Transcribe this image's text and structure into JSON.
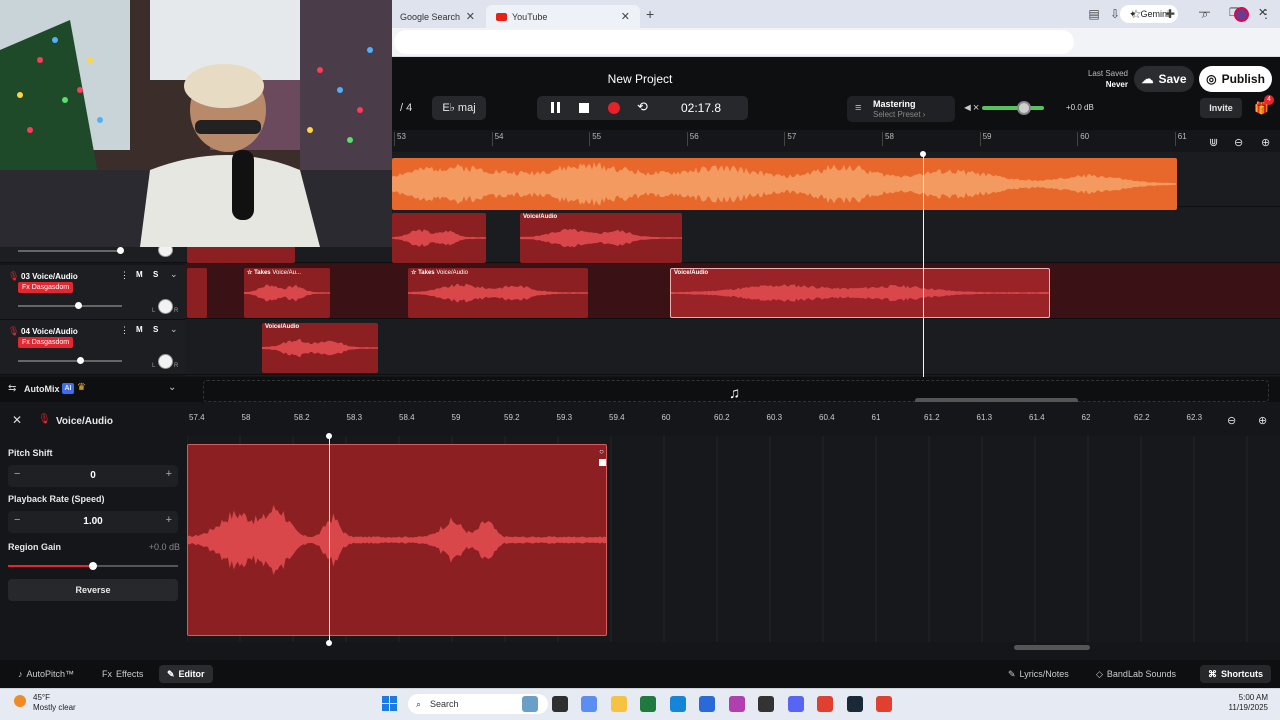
{
  "browser": {
    "tabs": [
      {
        "label": "Google Search"
      },
      {
        "label": "YouTube"
      }
    ],
    "new_tab": "+",
    "gemini": "Gemini",
    "close_glyph": "✕"
  },
  "header": {
    "title": "New Project",
    "last_saved_label": "Last Saved",
    "last_saved_value": "Never",
    "save": "Save",
    "publish": "Publish",
    "bpm_fragment": "/ 4",
    "key": "E♭ maj",
    "time": "02:17.8",
    "mastering": "Mastering",
    "mastering_preset": "Select Preset",
    "volume_readout": "+0.0 dB",
    "volume_level": 0.69,
    "invite": "Invite",
    "notification_count": "4"
  },
  "ruler": {
    "bars": [
      "53",
      "54",
      "55",
      "56",
      "57",
      "58",
      "59",
      "60",
      "61"
    ]
  },
  "tracks": [
    {
      "number": "03",
      "name": "Voice/Audio",
      "fx": "Fx Dasgasdom",
      "m": "M",
      "s": "S",
      "volume": 0.58
    },
    {
      "number": "04",
      "name": "Voice/Audio",
      "fx": "Fx Dasgasdom",
      "m": "M",
      "s": "S",
      "volume": 0.6
    }
  ],
  "regions": {
    "voice_audio": "Voice/Audio",
    "voice_audio_trunc": "Voice/Au...",
    "takes": "Takes"
  },
  "pan_labels": {
    "l": "L",
    "r": "R"
  },
  "automix": {
    "label": "AutoMix",
    "ai": "AI"
  },
  "editor": {
    "region_name": "Voice/Audio",
    "pitch_shift_label": "Pitch Shift",
    "pitch_shift_value": "0",
    "playback_rate_label": "Playback Rate (Speed)",
    "playback_rate_value": "1.00",
    "region_gain_label": "Region Gain",
    "region_gain_value": "+0.0 dB",
    "reverse": "Reverse",
    "minus": "−",
    "plus": "+",
    "ruler_ticks": [
      "57.4",
      "58",
      "58.2",
      "58.3",
      "58.4",
      "59",
      "59.2",
      "59.3",
      "59.4",
      "60",
      "60.2",
      "60.3",
      "60.4",
      "61",
      "61.2",
      "61.3",
      "61.4",
      "62",
      "62.2",
      "62.3"
    ]
  },
  "bottom": {
    "autopitch": "AutoPitch™",
    "effects": "Effects",
    "editor": "Editor",
    "lyrics": "Lyrics/Notes",
    "sounds": "BandLab Sounds",
    "shortcuts": "Shortcuts"
  },
  "taskbar": {
    "temperature": "45°F",
    "weather": "Mostly clear",
    "search": "Search",
    "time": "5:00 AM",
    "date": "11/19/2025"
  },
  "colors": {
    "accent_red": "#e3262f",
    "region_orange": "#e8672a",
    "region_red": "#8b1f22",
    "volume_green": "#57c45a"
  }
}
